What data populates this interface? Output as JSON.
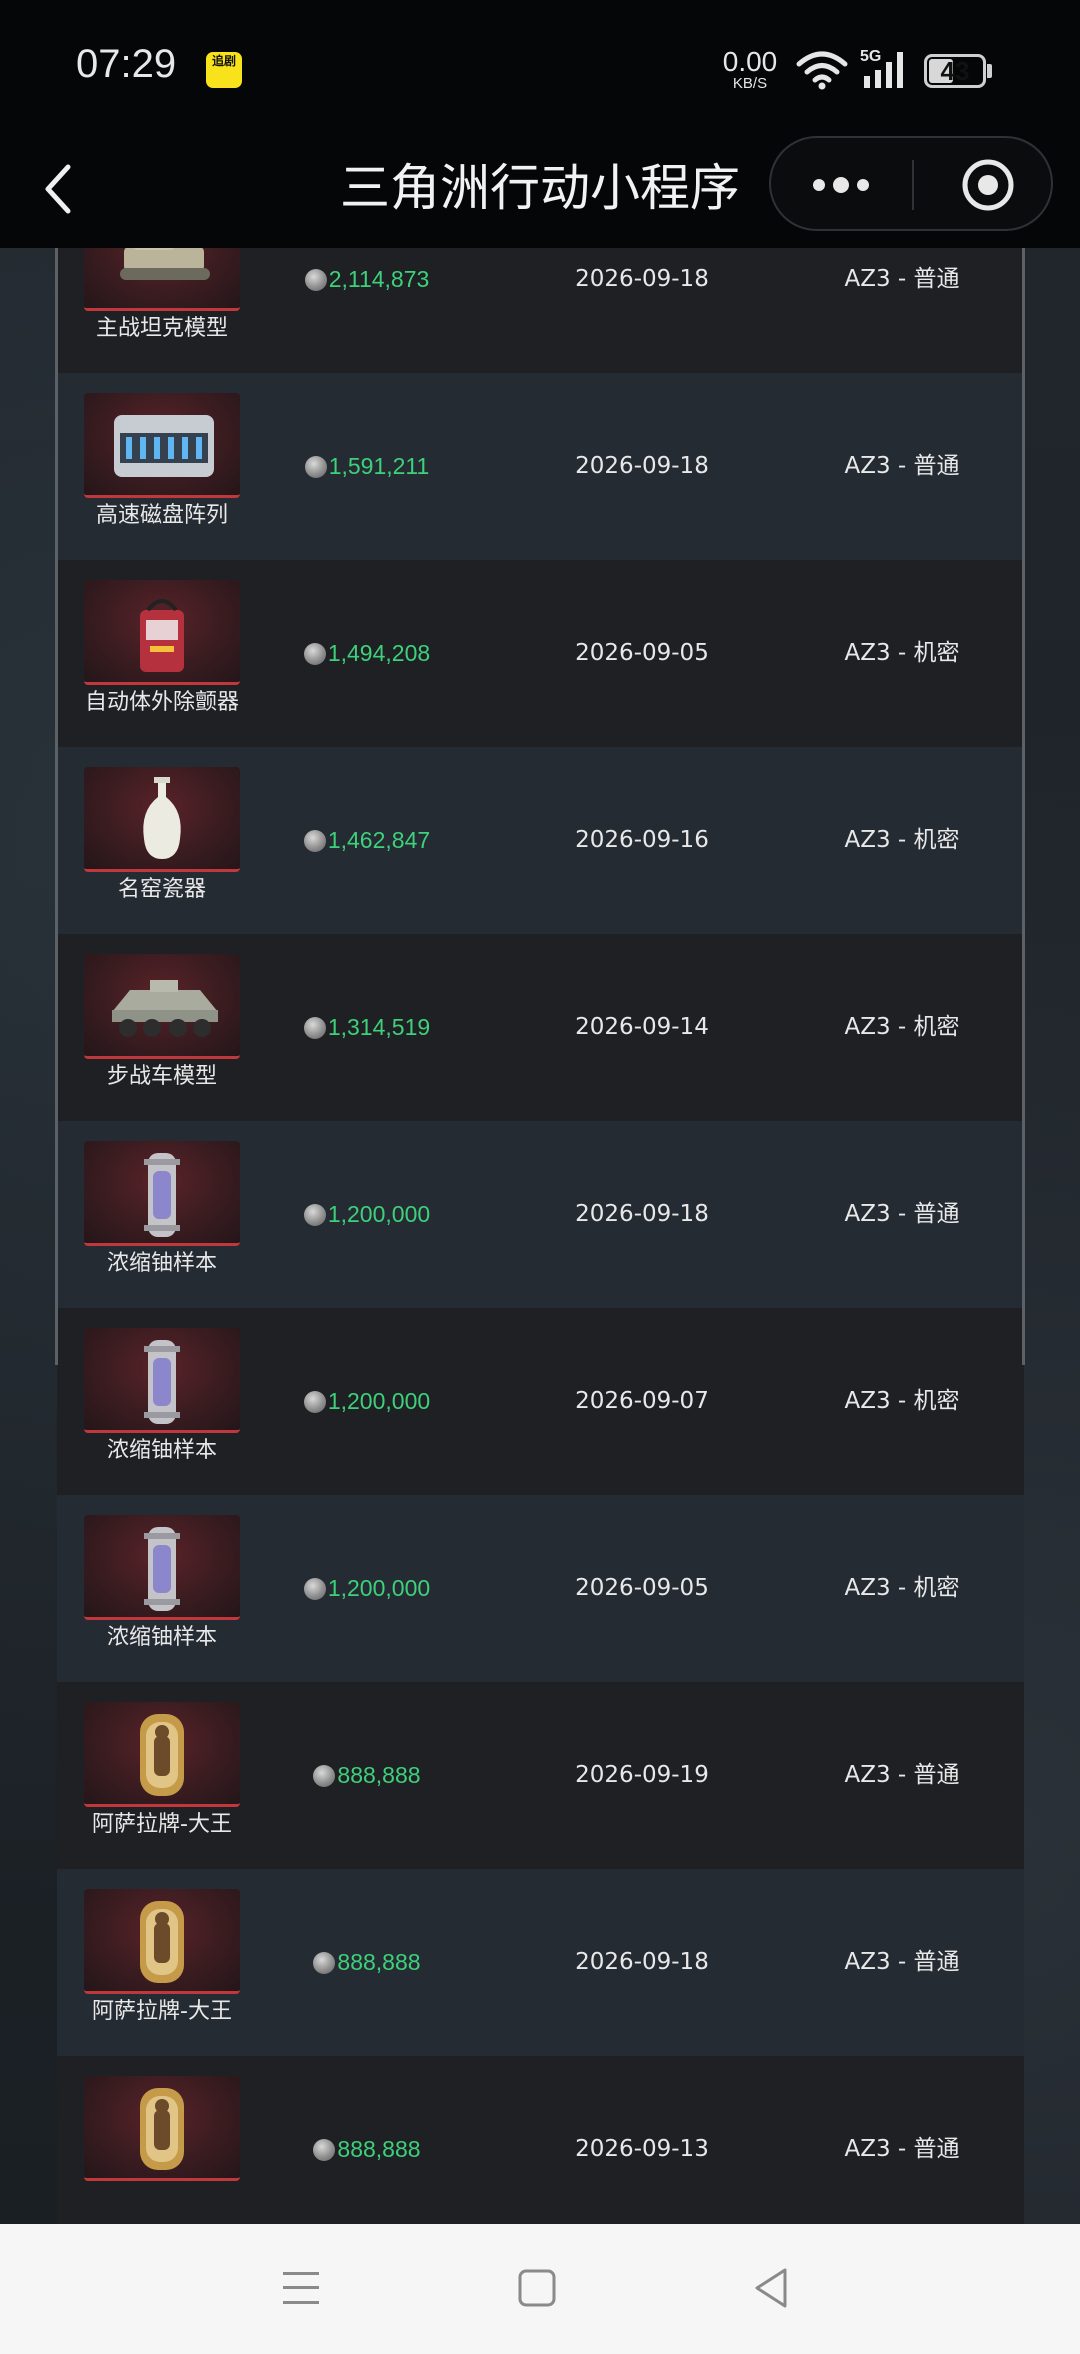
{
  "status_bar": {
    "time": "07:29",
    "app_badge": "追剧",
    "net_speed_value": "0.00",
    "net_speed_unit": "KB/S",
    "network_type": "5G",
    "battery": "43"
  },
  "nav": {
    "title": "三角洲行动小程序"
  },
  "icons": {
    "back": "chevron-left-icon",
    "more": "more-dots-icon",
    "close": "target-circle-icon",
    "coin": "coin-icon"
  },
  "colors": {
    "price": "#3ed07b",
    "row_dark": "#1e2024",
    "row_light": "#252b33",
    "thumb_accent": "#c0383c"
  },
  "rows": [
    {
      "name": "主战坦克模型",
      "price": "2,114,873",
      "date": "2026-09-18",
      "zone": "AZ3 - 普通",
      "icon": "tank-model-icon"
    },
    {
      "name": "高速磁盘阵列",
      "price": "1,591,211",
      "date": "2026-09-18",
      "zone": "AZ3 - 普通",
      "icon": "disk-array-icon"
    },
    {
      "name": "自动体外除颤器",
      "price": "1,494,208",
      "date": "2026-09-05",
      "zone": "AZ3 - 机密",
      "icon": "defibrillator-icon"
    },
    {
      "name": "名窑瓷器",
      "price": "1,462,847",
      "date": "2026-09-16",
      "zone": "AZ3 - 机密",
      "icon": "porcelain-vase-icon"
    },
    {
      "name": "步战车模型",
      "price": "1,314,519",
      "date": "2026-09-14",
      "zone": "AZ3 - 机密",
      "icon": "ifv-model-icon"
    },
    {
      "name": "浓缩铀样本",
      "price": "1,200,000",
      "date": "2026-09-18",
      "zone": "AZ3 - 普通",
      "icon": "uranium-sample-icon"
    },
    {
      "name": "浓缩铀样本",
      "price": "1,200,000",
      "date": "2026-09-07",
      "zone": "AZ3 - 机密",
      "icon": "uranium-sample-icon"
    },
    {
      "name": "浓缩铀样本",
      "price": "1,200,000",
      "date": "2026-09-05",
      "zone": "AZ3 - 机密",
      "icon": "uranium-sample-icon"
    },
    {
      "name": "阿萨拉牌-大王",
      "price": "888,888",
      "date": "2026-09-19",
      "zone": "AZ3 - 普通",
      "icon": "asala-card-icon"
    },
    {
      "name": "阿萨拉牌-大王",
      "price": "888,888",
      "date": "2026-09-18",
      "zone": "AZ3 - 普通",
      "icon": "asala-card-icon"
    },
    {
      "name": "",
      "price": "888,888",
      "date": "2026-09-13",
      "zone": "AZ3 - 普通",
      "icon": "asala-card-icon"
    }
  ],
  "system_nav": {
    "menu": "menu-icon",
    "home": "home-square-icon",
    "back": "back-triangle-icon"
  }
}
